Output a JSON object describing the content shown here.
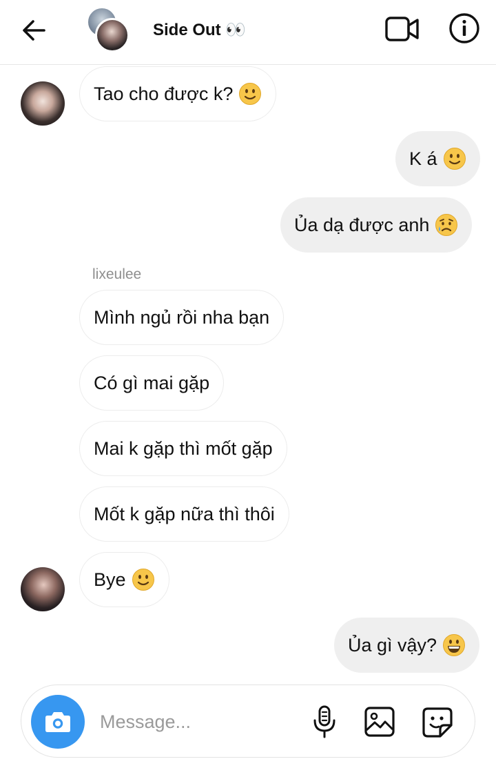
{
  "header": {
    "title": "Side Out 👀"
  },
  "conversation": {
    "sender_name": "lixeulee",
    "messages": [
      {
        "text": "Tao cho được k?",
        "emoji": "slightly-smiling-face-icon"
      },
      {
        "text": "K á",
        "emoji": "slightly-smiling-face-icon"
      },
      {
        "text": "Ủa dạ được anh",
        "emoji": "sad-but-relieved-face-icon"
      },
      {
        "text": "Mình ngủ rồi nha bạn"
      },
      {
        "text": "Có gì mai gặp"
      },
      {
        "text": "Mai k gặp thì mốt gặp"
      },
      {
        "text": "Mốt k gặp nữa thì thôi"
      },
      {
        "text": "Bye",
        "emoji": "slightly-smiling-face-icon"
      },
      {
        "text": "Ủa gì vậy?",
        "emoji": "grinning-face-icon"
      }
    ]
  },
  "composer": {
    "placeholder": "Message..."
  },
  "colors": {
    "accent": "#3797f0",
    "outgoing_bubble": "#efefef",
    "incoming_border": "#ececec",
    "emoji_yellow": "#f7c64a"
  }
}
